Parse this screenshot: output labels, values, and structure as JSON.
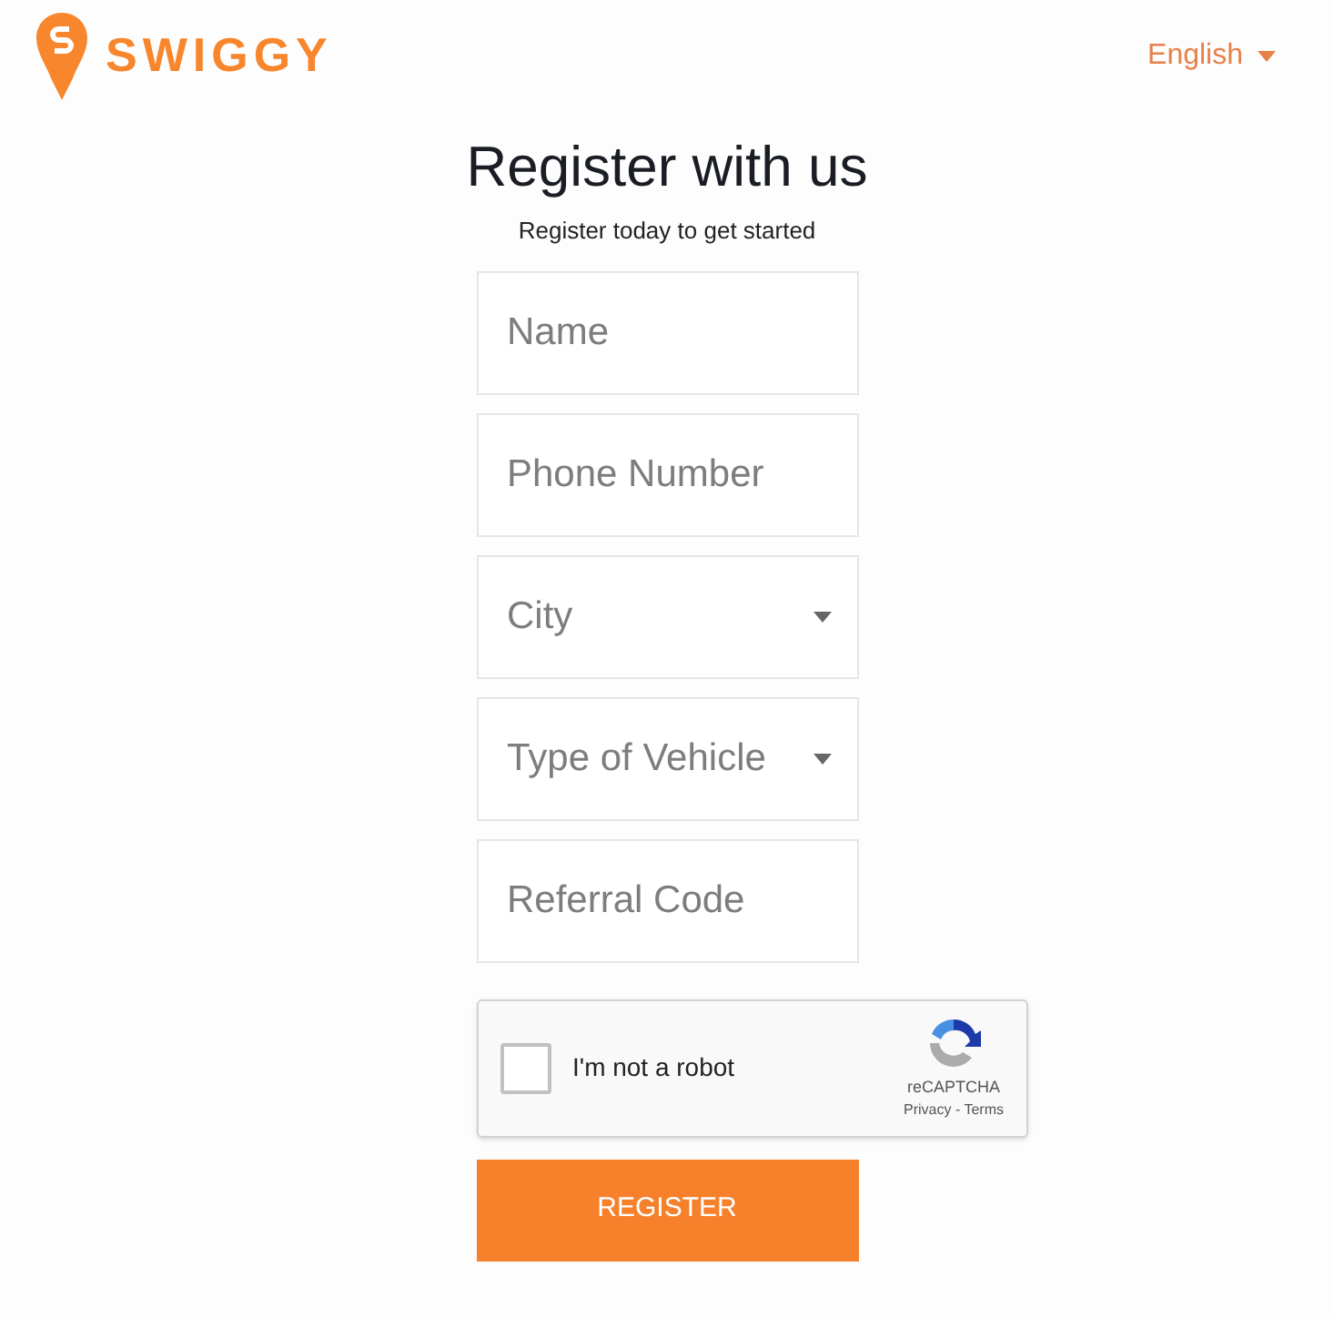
{
  "header": {
    "logo_text": "SWIGGY",
    "language": "English"
  },
  "form": {
    "title": "Register with us",
    "subtitle": "Register today to get started",
    "fields": [
      {
        "kind": "input",
        "placeholder": "Name"
      },
      {
        "kind": "input",
        "placeholder": "Phone Number"
      },
      {
        "kind": "select",
        "placeholder": "City"
      },
      {
        "kind": "select",
        "placeholder": "Type of Vehicle"
      },
      {
        "kind": "input",
        "placeholder": "Referral Code"
      }
    ],
    "captcha": {
      "label": "I'm not a robot",
      "checked": false,
      "brand": "reCAPTCHA",
      "links": "Privacy - Terms"
    },
    "submit": "REGISTER"
  }
}
